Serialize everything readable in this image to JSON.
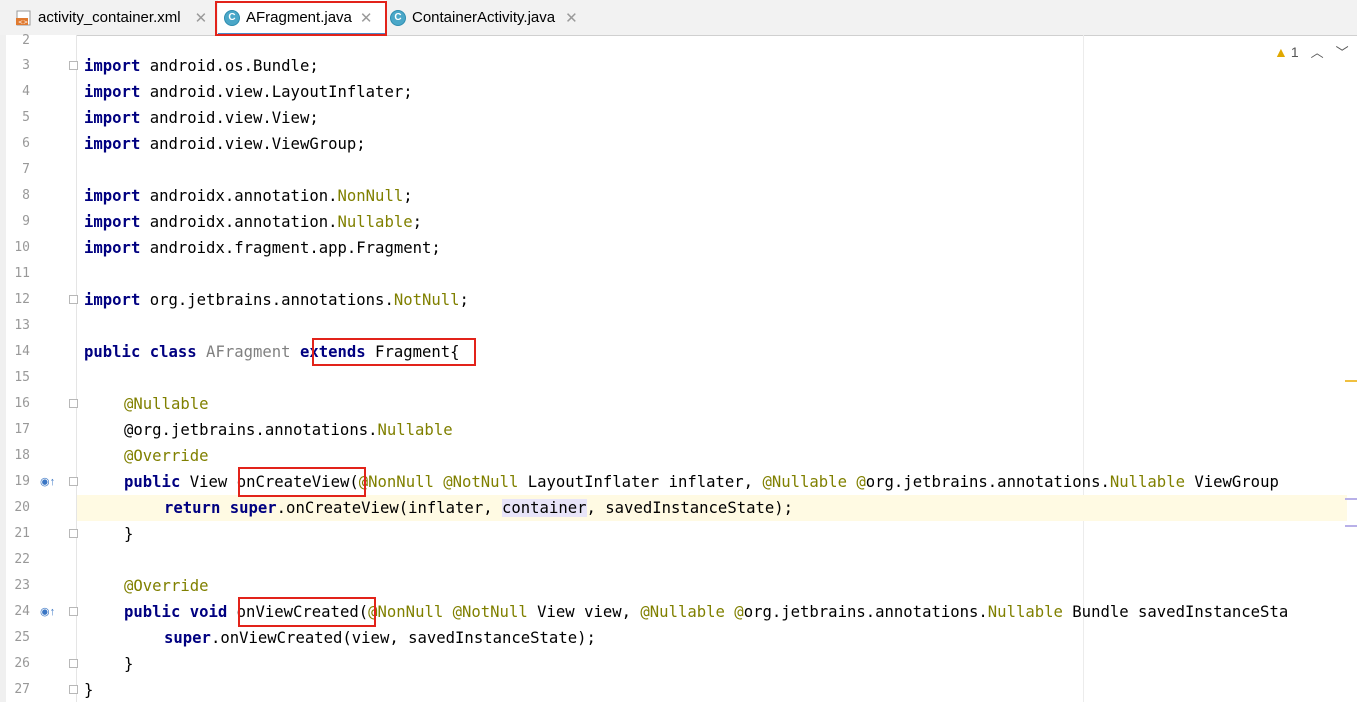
{
  "tabs": [
    {
      "label": "activity_container.xml",
      "icon": "xml-file-icon",
      "active": false
    },
    {
      "label": "AFragment.java",
      "icon": "java-class-icon",
      "active": true
    },
    {
      "label": "ContainerActivity.java",
      "icon": "java-class-icon",
      "active": false
    }
  ],
  "inspection": {
    "warning_count": "1"
  },
  "colors": {
    "keyword": "#000080",
    "annotation": "#808000",
    "highlight_box": "#e2231a",
    "current_line": "#fffae3"
  },
  "line_numbers": [
    "2",
    "3",
    "4",
    "5",
    "6",
    "7",
    "8",
    "9",
    "10",
    "11",
    "12",
    "13",
    "14",
    "15",
    "16",
    "17",
    "18",
    "19",
    "20",
    "21",
    "22",
    "23",
    "24",
    "25",
    "26",
    "27"
  ],
  "code": {
    "l3_kw": "import",
    "l3_rest": " android.os.Bundle;",
    "l4_kw": "import",
    "l4_rest": " android.view.LayoutInflater;",
    "l5_kw": "import",
    "l5_rest": " android.view.View;",
    "l6_kw": "import",
    "l6_rest": " android.view.ViewGroup;",
    "l8_kw": "import",
    "l8_a": " androidx.annotation.",
    "l8_b": "NonNull",
    "l8_c": ";",
    "l9_kw": "import",
    "l9_a": " androidx.annotation.",
    "l9_b": "Nullable",
    "l9_c": ";",
    "l10_kw": "import",
    "l10_rest": " androidx.fragment.app.Fragment;",
    "l12_kw": "import",
    "l12_a": " org.jetbrains.annotations.",
    "l12_b": "NotNull",
    "l12_c": ";",
    "l14_kw1": "public class",
    "l14_name": " AFragment ",
    "l14_kw2": "extends",
    "l14_rest": " Fragment{",
    "l16": "@Nullable",
    "l17_a": "@org.jetbrains.annotations.",
    "l17_b": "Nullable",
    "l18": "@Override",
    "l19_kw": "public",
    "l19_a": " View ",
    "l19_m": "onCreateView",
    "l19_b": "(",
    "l19_c": "@NonNull @NotNull",
    "l19_d": " LayoutInflater inflater, ",
    "l19_e": "@Nullable @",
    "l19_f": "org.jetbrains.annotations.",
    "l19_g": "Nullable",
    "l19_h": " ViewGroup",
    "l20_kw": "return super",
    "l20_a": ".onCreateView(inflater, ",
    "l20_b": "container",
    "l20_c": ", savedInstanceState);",
    "l21": "}",
    "l23": "@Override",
    "l24_kw": "public void",
    "l24_a": " ",
    "l24_m": "onViewCreated",
    "l24_b": "(",
    "l24_c": "@NonNull @NotNull",
    "l24_d": " View view, ",
    "l24_e": "@Nullable @",
    "l24_f": "org.jetbrains.annotations.",
    "l24_g": "Nullable",
    "l24_h": " Bundle savedInstanceSta",
    "l25_kw": "super",
    "l25_a": ".onViewCreated(view, savedInstanceState);",
    "l26": "}",
    "l27": "}"
  }
}
